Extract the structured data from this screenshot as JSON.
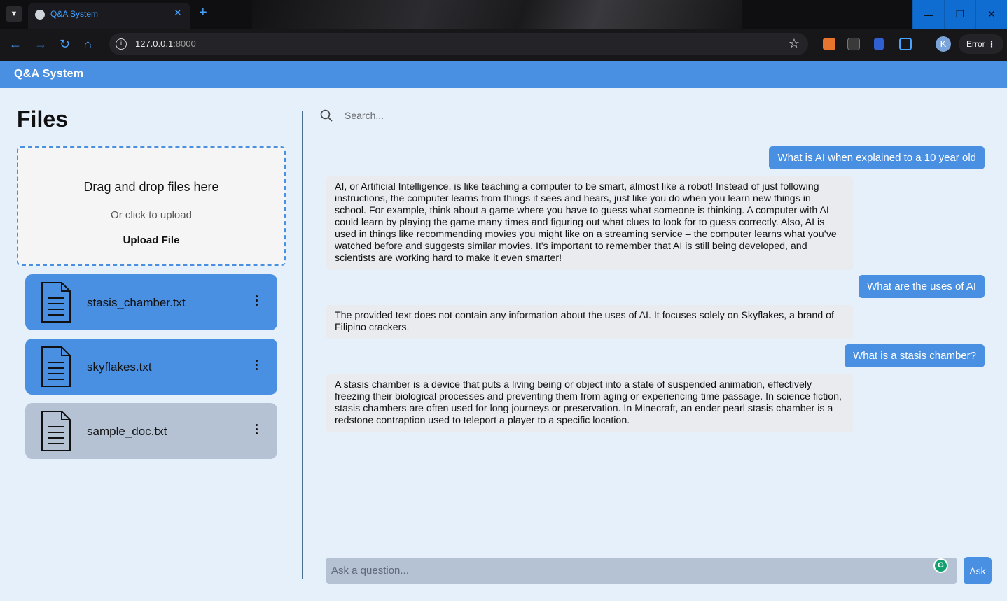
{
  "browser": {
    "tab_title": "Q&A System",
    "tab_close": "✕",
    "new_tab": "+",
    "url_host": "127.0.0.1",
    "url_port": ":8000",
    "profile_initial": "K",
    "error_label": "Error",
    "window_minimize": "—",
    "window_restore": "❐",
    "window_close": "✕"
  },
  "app": {
    "title": "Q&A System"
  },
  "sidebar": {
    "title": "Files",
    "dropzone": {
      "title": "Drag and drop files here",
      "subtitle": "Or click to upload",
      "button": "Upload File"
    },
    "files": [
      {
        "name": "stasis_chamber.txt",
        "active": true
      },
      {
        "name": "skyflakes.txt",
        "active": true
      },
      {
        "name": "sample_doc.txt",
        "active": false
      }
    ]
  },
  "search": {
    "placeholder": "Search..."
  },
  "chat": {
    "messages": [
      {
        "role": "user",
        "text": "What is AI when explained to a 10 year old"
      },
      {
        "role": "assistant",
        "text": "AI, or Artificial Intelligence, is like teaching a computer to be smart, almost like a robot! Instead of just following instructions, the computer learns from things it sees and hears, just like you do when you learn new things in school. For example, think about a game where you have to guess what someone is thinking. A computer with AI could learn by playing the game many times and figuring out what clues to look for to guess correctly. Also, AI is used in things like recommending movies you might like on a streaming service – the computer learns what you’ve watched before and suggests similar movies. It's important to remember that AI is still being developed, and scientists are working hard to make it even smarter!"
      },
      {
        "role": "user",
        "text": "What are the uses of AI"
      },
      {
        "role": "assistant",
        "text": "The provided text does not contain any information about the uses of AI. It focuses solely on Skyflakes, a brand of Filipino crackers."
      },
      {
        "role": "user",
        "text": "What is a stasis chamber?"
      },
      {
        "role": "assistant",
        "text": "A stasis chamber is a device that puts a living being or object into a state of suspended animation, effectively freezing their biological processes and preventing them from aging or experiencing time passage. In science fiction, stasis chambers are often used for long journeys or preservation. In Minecraft, an ender pearl stasis chamber is a redstone contraption used to teleport a player to a specific location."
      }
    ]
  },
  "ask": {
    "placeholder": "Ask a question...",
    "button": "Ask"
  },
  "colors": {
    "accent": "#4a90e2",
    "background": "#e6f0fb",
    "inactive_file": "#b4c2d4",
    "bot_bubble": "#e9ebee"
  }
}
